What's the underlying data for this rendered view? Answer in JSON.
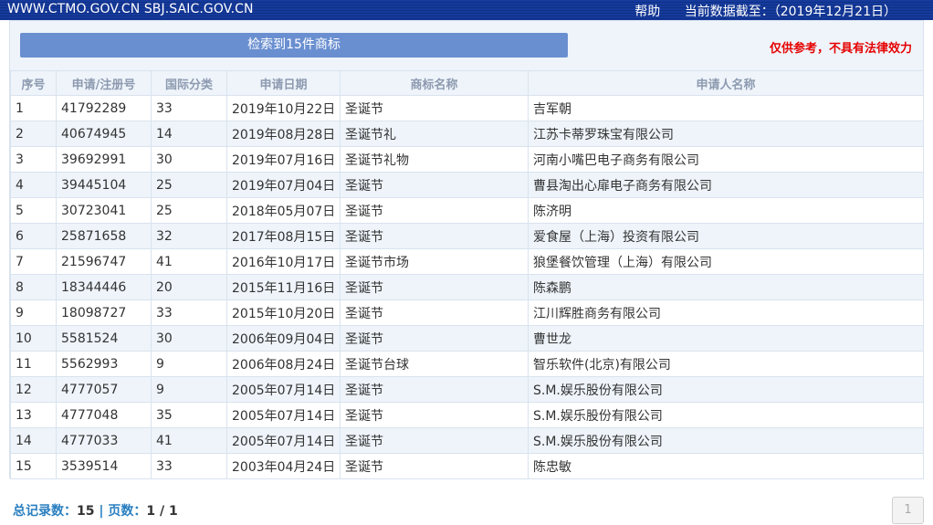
{
  "header": {
    "sites": "WWW.CTMO.GOV.CN SBJ.SAIC.GOV.CN",
    "help": "帮助",
    "data_date": "当前数据截至：（2019年12月21日）"
  },
  "search_button": "检索到15件商标",
  "disclaimer": "仅供参考，不具有法律效力",
  "table": {
    "columns": [
      "序号",
      "申请/注册号",
      "国际分类",
      "申请日期",
      "商标名称",
      "申请人名称"
    ],
    "rows": [
      {
        "no": "1",
        "reg": "41792289",
        "cls": "33",
        "date": "2019年10月22日",
        "mark": "圣诞节",
        "applicant": "吉军朝"
      },
      {
        "no": "2",
        "reg": "40674945",
        "cls": "14",
        "date": "2019年08月28日",
        "mark": "圣诞节礼",
        "applicant": "江苏卡蒂罗珠宝有限公司"
      },
      {
        "no": "3",
        "reg": "39692991",
        "cls": "30",
        "date": "2019年07月16日",
        "mark": "圣诞节礼物",
        "applicant": "河南小嘴巴电子商务有限公司"
      },
      {
        "no": "4",
        "reg": "39445104",
        "cls": "25",
        "date": "2019年07月04日",
        "mark": "圣诞节",
        "applicant": "曹县淘出心扉电子商务有限公司"
      },
      {
        "no": "5",
        "reg": "30723041",
        "cls": "25",
        "date": "2018年05月07日",
        "mark": "圣诞节",
        "applicant": "陈济明"
      },
      {
        "no": "6",
        "reg": "25871658",
        "cls": "32",
        "date": "2017年08月15日",
        "mark": "圣诞节",
        "applicant": "爱食屋（上海）投资有限公司"
      },
      {
        "no": "7",
        "reg": "21596747",
        "cls": "41",
        "date": "2016年10月17日",
        "mark": "圣诞节市场",
        "applicant": "狼堡餐饮管理（上海）有限公司"
      },
      {
        "no": "8",
        "reg": "18344446",
        "cls": "20",
        "date": "2015年11月16日",
        "mark": "圣诞节",
        "applicant": "陈森鹏"
      },
      {
        "no": "9",
        "reg": "18098727",
        "cls": "33",
        "date": "2015年10月20日",
        "mark": "圣诞节",
        "applicant": "江川辉胜商务有限公司"
      },
      {
        "no": "10",
        "reg": "5581524",
        "cls": "30",
        "date": "2006年09月04日",
        "mark": "圣诞节",
        "applicant": "曹世龙"
      },
      {
        "no": "11",
        "reg": "5562993",
        "cls": "9",
        "date": "2006年08月24日",
        "mark": "圣诞节台球",
        "applicant": "智乐软件(北京)有限公司"
      },
      {
        "no": "12",
        "reg": "4777057",
        "cls": "9",
        "date": "2005年07月14日",
        "mark": "圣诞节",
        "applicant": "S.M.娱乐股份有限公司"
      },
      {
        "no": "13",
        "reg": "4777048",
        "cls": "35",
        "date": "2005年07月14日",
        "mark": "圣诞节",
        "applicant": "S.M.娱乐股份有限公司"
      },
      {
        "no": "14",
        "reg": "4777033",
        "cls": "41",
        "date": "2005年07月14日",
        "mark": "圣诞节",
        "applicant": "S.M.娱乐股份有限公司"
      },
      {
        "no": "15",
        "reg": "3539514",
        "cls": "33",
        "date": "2003年04月24日",
        "mark": "圣诞节",
        "applicant": "陈忠敏"
      }
    ]
  },
  "footer": {
    "total_label": "总记录数：",
    "total": "15",
    "sep": " | ",
    "pages_label": "页数：",
    "pages": "1 / 1"
  },
  "pager": {
    "page": "1"
  }
}
